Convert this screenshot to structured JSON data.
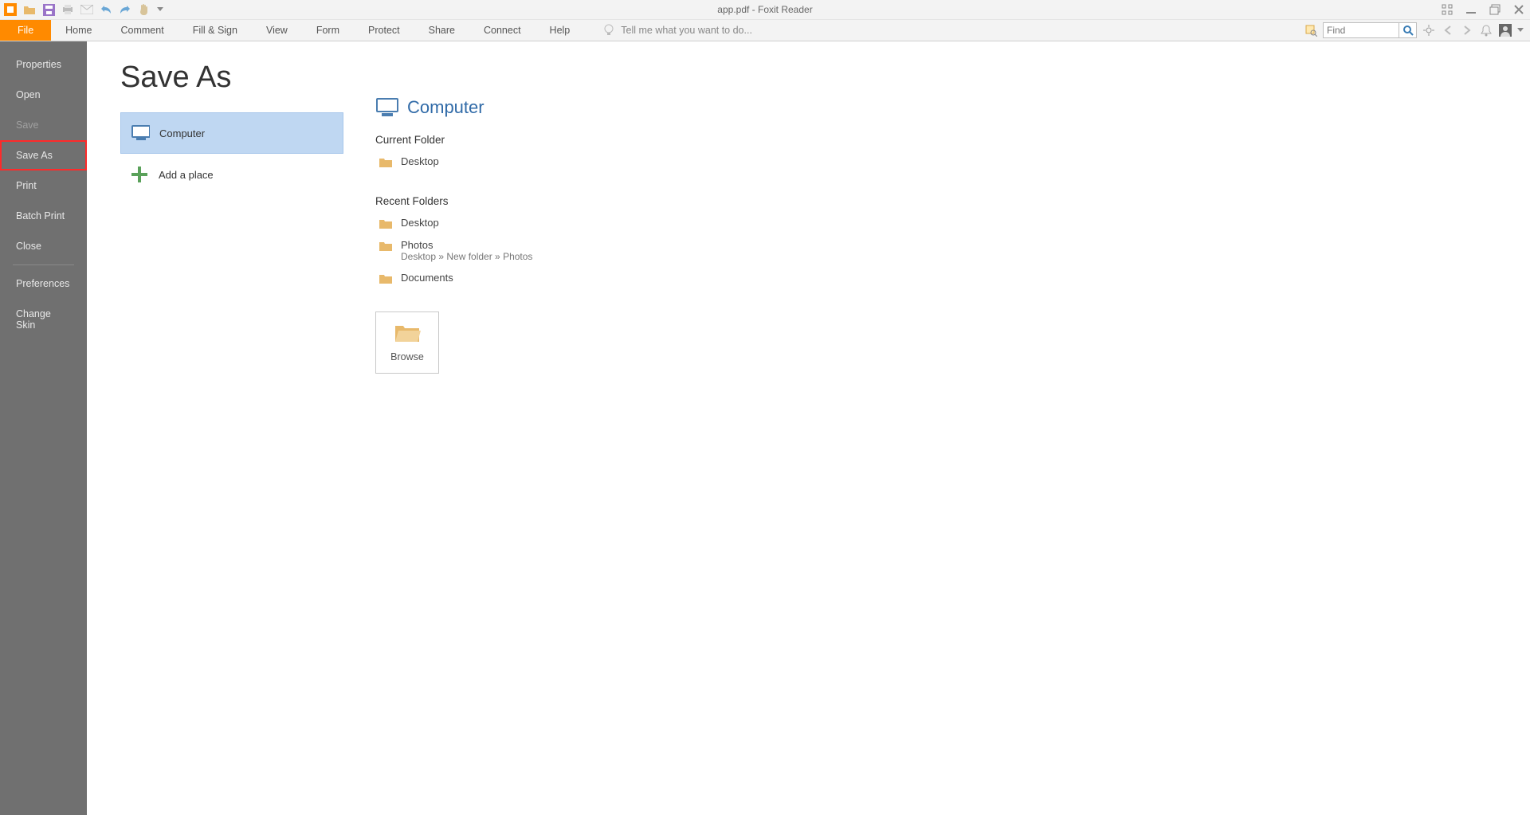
{
  "titlebar": {
    "title": "app.pdf - Foxit Reader"
  },
  "menubar": {
    "tabs": [
      "File",
      "Home",
      "Comment",
      "Fill & Sign",
      "View",
      "Form",
      "Protect",
      "Share",
      "Connect",
      "Help"
    ],
    "tellme_placeholder": "Tell me what you want to do...",
    "find_placeholder": "Find"
  },
  "sidebar": {
    "items": [
      {
        "label": "Properties",
        "state": ""
      },
      {
        "label": "Open",
        "state": ""
      },
      {
        "label": "Save",
        "state": "disabled"
      },
      {
        "label": "Save As",
        "state": "active"
      },
      {
        "label": "Print",
        "state": ""
      },
      {
        "label": "Batch Print",
        "state": ""
      },
      {
        "label": "Close",
        "state": ""
      },
      {
        "label": "Preferences",
        "state": ""
      },
      {
        "label": "Change Skin",
        "state": ""
      }
    ]
  },
  "page": {
    "title": "Save As",
    "locations": {
      "computer": "Computer",
      "add_place": "Add a place"
    },
    "right": {
      "header": "Computer",
      "current_label": "Current Folder",
      "current_folder": "Desktop",
      "recent_label": "Recent Folders",
      "recent": [
        {
          "name": "Desktop",
          "path": ""
        },
        {
          "name": "Photos",
          "path": "Desktop » New folder » Photos"
        },
        {
          "name": "Documents",
          "path": ""
        }
      ],
      "browse": "Browse"
    }
  }
}
